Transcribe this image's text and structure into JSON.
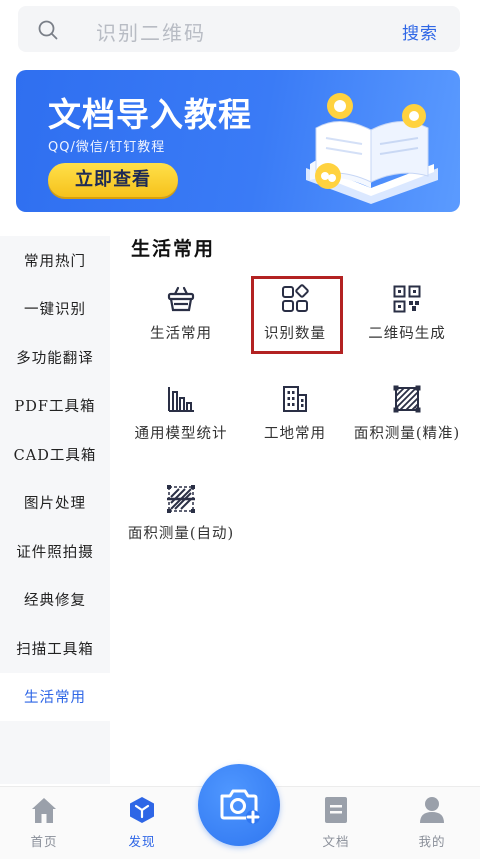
{
  "search": {
    "placeholder": "识别二维码",
    "button_label": "搜索"
  },
  "banner": {
    "title": "文档导入教程",
    "subtitle": "QQ/微信/钉钉教程",
    "button_label": "立即查看"
  },
  "sidebar": {
    "items": [
      {
        "label": "常用热门"
      },
      {
        "label": "一键识别"
      },
      {
        "label": "多功能翻译"
      },
      {
        "label": "PDF工具箱"
      },
      {
        "label": "CAD工具箱"
      },
      {
        "label": "图片处理"
      },
      {
        "label": "证件照拍摄"
      },
      {
        "label": "经典修复"
      },
      {
        "label": "扫描工具箱"
      },
      {
        "label": "生活常用"
      }
    ],
    "active_index": 9
  },
  "section": {
    "title": "生活常用",
    "items": [
      {
        "label": "生活常用",
        "icon": "basket-icon"
      },
      {
        "label": "识别数量",
        "icon": "apps-grid-icon",
        "highlighted": true
      },
      {
        "label": "二维码生成",
        "icon": "qr-code-icon"
      },
      {
        "label": "通用模型统计",
        "icon": "bar-chart-icon"
      },
      {
        "label": "工地常用",
        "icon": "building-icon"
      },
      {
        "label": "面积测量(精准)",
        "icon": "area-measure-icon"
      },
      {
        "label": "面积测量(自动)",
        "icon": "area-measure-auto-icon"
      }
    ]
  },
  "bottom_nav": {
    "items": [
      {
        "label": "首页",
        "icon": "home-icon"
      },
      {
        "label": "发现",
        "icon": "discover-cube-icon",
        "active": true
      },
      {
        "label": "文档",
        "icon": "document-icon"
      },
      {
        "label": "我的",
        "icon": "user-icon"
      }
    ],
    "camera_icon": "camera-add-icon"
  },
  "colors": {
    "accent": "#2e66e6",
    "banner": "#3a7bf6",
    "banner_button": "#f6c21c",
    "highlight": "#b32222"
  }
}
